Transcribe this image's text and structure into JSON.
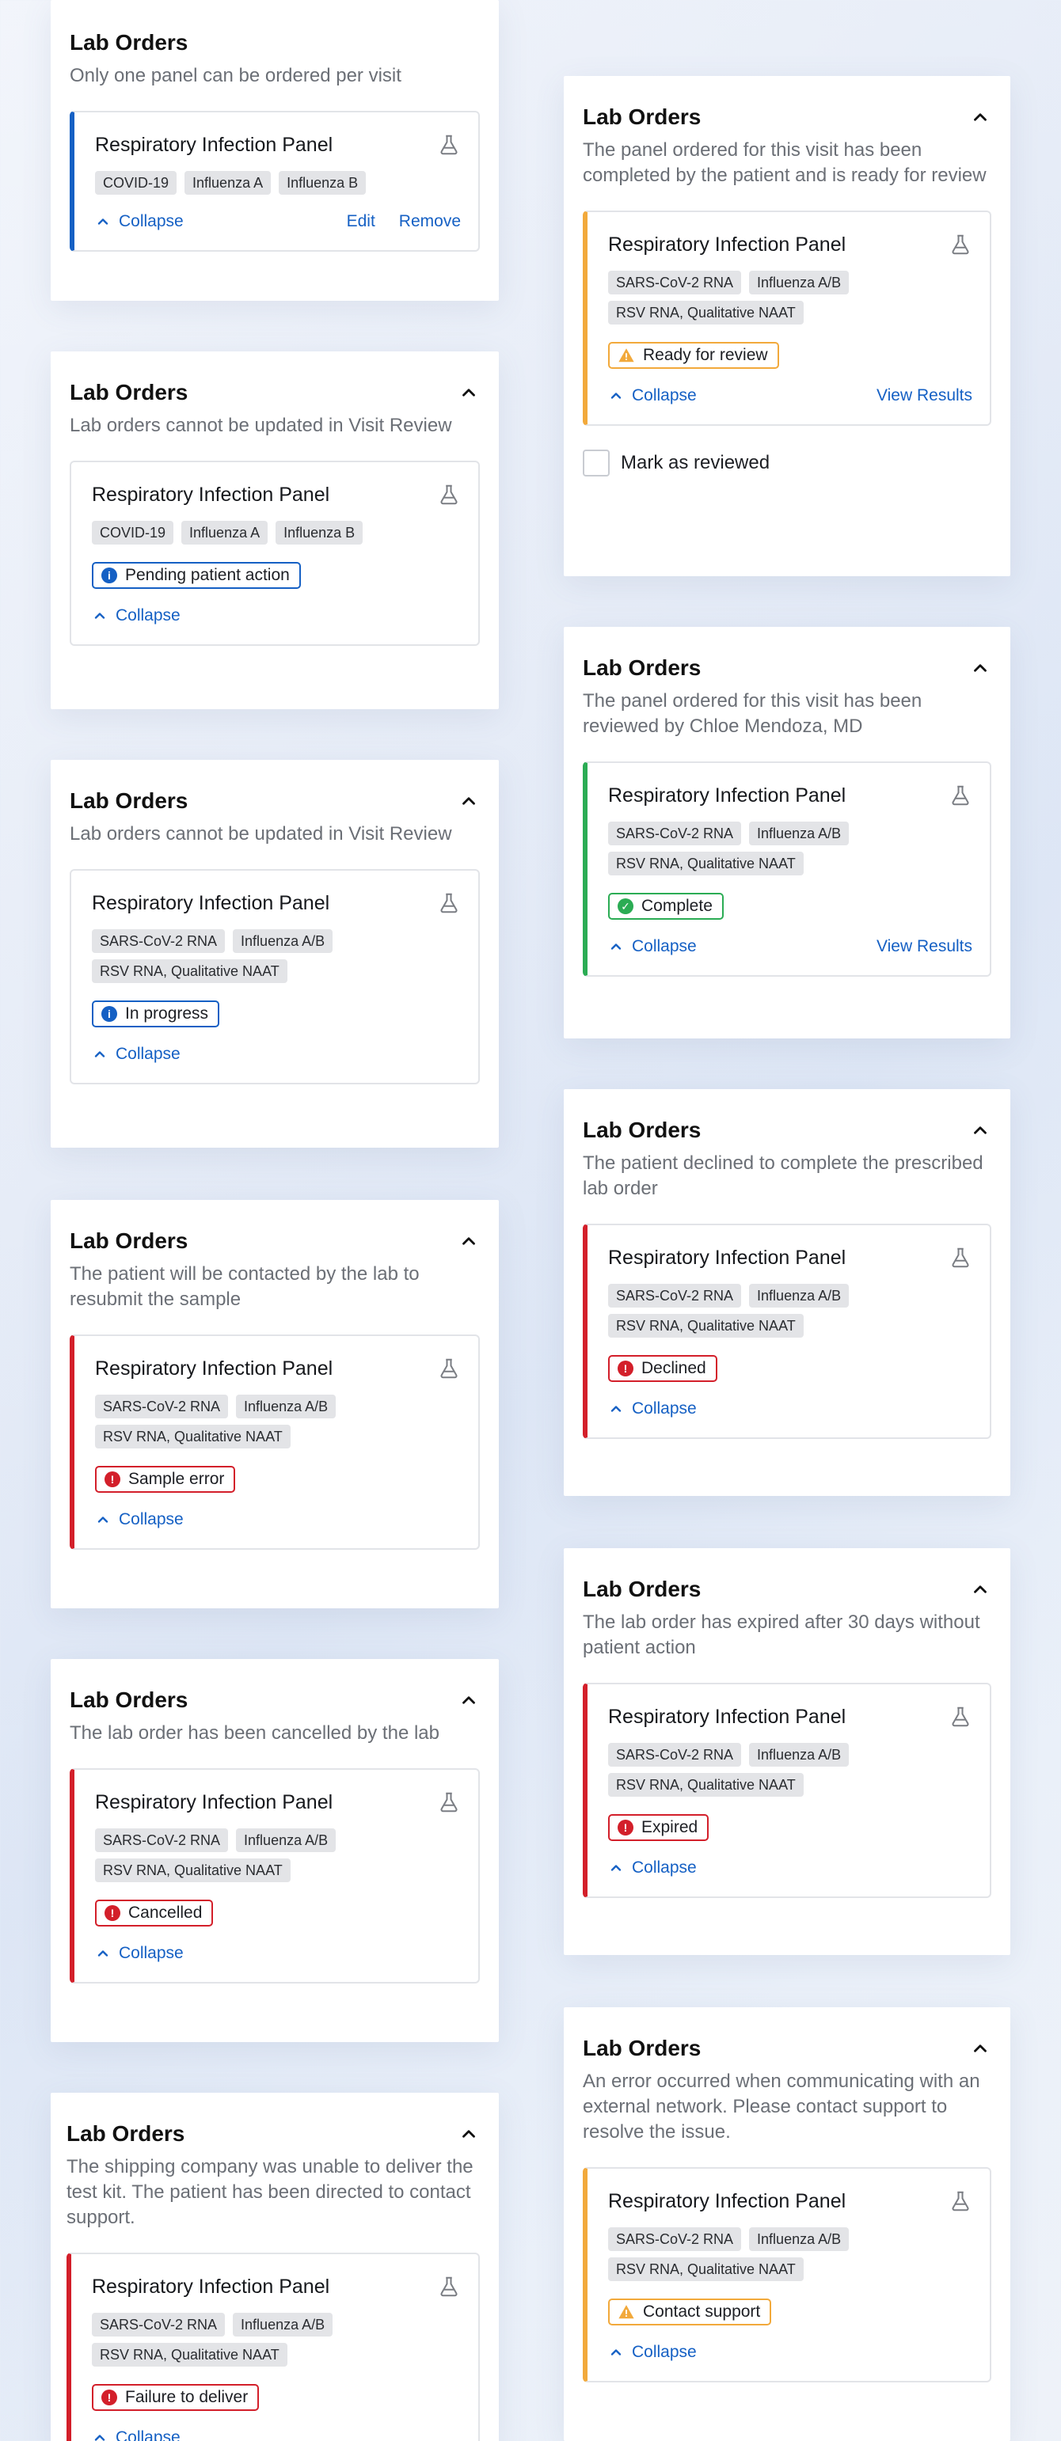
{
  "common": {
    "title": "Lab Orders",
    "panel_name": "Respiratory Infection Panel",
    "collapse": "Collapse",
    "edit": "Edit",
    "remove": "Remove",
    "view_results": "View Results",
    "tags_a": [
      "COVID-19",
      "Influenza A",
      "Influenza B"
    ],
    "tags_b": [
      "SARS-CoV-2 RNA",
      "Influenza A/B",
      "RSV RNA, Qualitative NAAT"
    ]
  },
  "cards": {
    "c1": {
      "subtitle": "Only one panel can be ordered per visit"
    },
    "c2": {
      "subtitle": "Lab orders cannot be updated in Visit Review",
      "status": "Pending patient action"
    },
    "c3": {
      "subtitle": "Lab orders cannot be updated in Visit Review",
      "status": "In progress"
    },
    "c4": {
      "subtitle": "The patient will be contacted by the lab to resubmit the sample",
      "status": "Sample error"
    },
    "c5": {
      "subtitle": "The lab order has been cancelled by the lab",
      "status": "Cancelled"
    },
    "c6": {
      "subtitle": "The shipping company was unable to deliver the test kit. The patient has been directed to contact support.",
      "status": "Failure to deliver"
    },
    "r1": {
      "subtitle": "The panel ordered for this visit has been completed by the patient and is ready for review",
      "status": "Ready for review",
      "checkbox_label": "Mark as reviewed"
    },
    "r2": {
      "subtitle": "The panel ordered for this visit has been reviewed by Chloe Mendoza, MD",
      "status": "Complete"
    },
    "r3": {
      "subtitle": "The patient declined to complete the prescribed lab order",
      "status": "Declined"
    },
    "r4": {
      "subtitle": "The lab order has expired after 30 days without patient action",
      "status": "Expired"
    },
    "r5": {
      "subtitle": "An error occurred when communicating with an external network. Please contact support to resolve the issue.",
      "status": "Contact support"
    }
  },
  "colors": {
    "link_blue": "#1560c4",
    "warning_orange": "#f2a93b",
    "success_green": "#2bac54",
    "error_red": "#d31f2a"
  }
}
